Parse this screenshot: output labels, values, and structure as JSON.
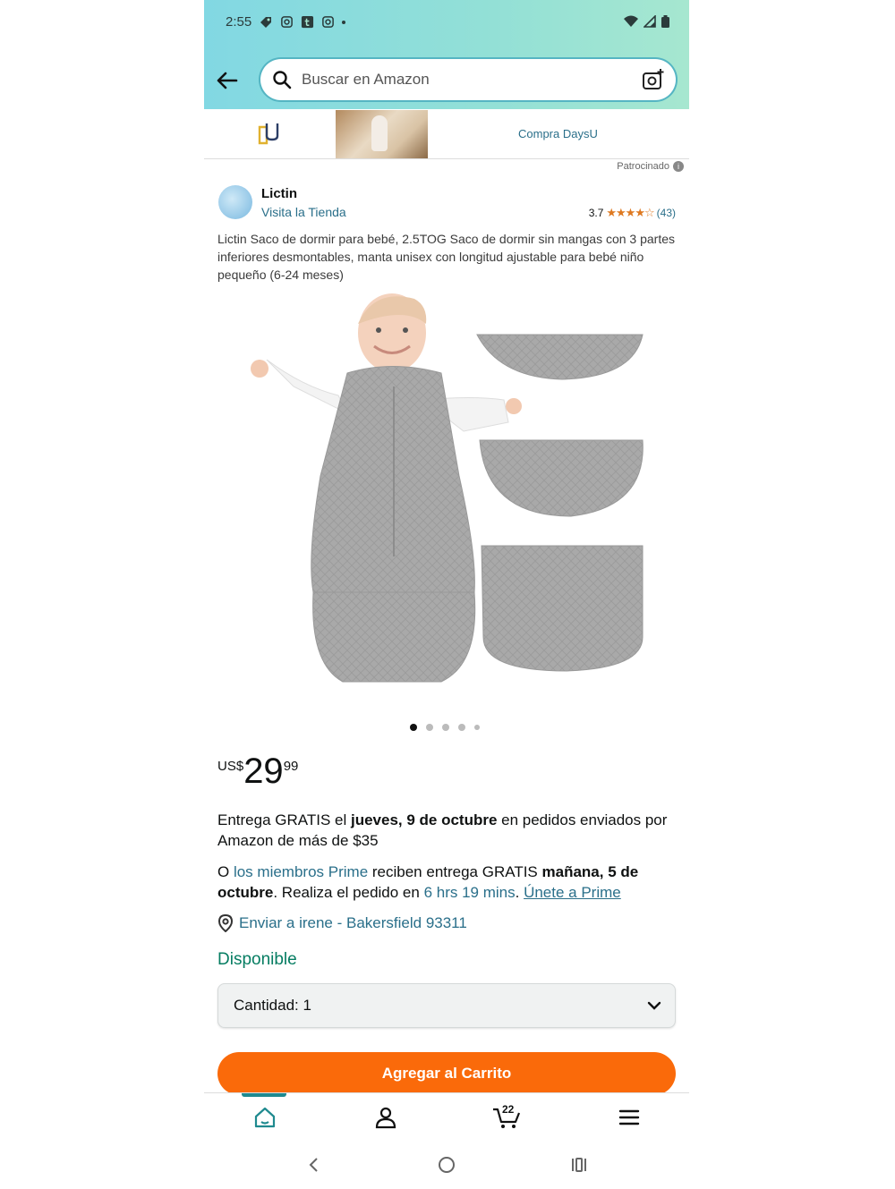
{
  "status_bar": {
    "time": "2:55"
  },
  "search": {
    "placeholder": "Buscar en Amazon"
  },
  "ad": {
    "link_text": "Compra DaysU",
    "sponsored_label": "Patrocinado"
  },
  "brand": {
    "name": "Lictin",
    "visit_store": "Visita la Tienda"
  },
  "rating": {
    "value": "3.7",
    "stars": "★★★★☆",
    "count": "(43)"
  },
  "product": {
    "title": "Lictin Saco de dormir para bebé, 2.5TOG Saco de dormir sin mangas con 3 partes inferiores desmontables, manta unisex con longitud ajustable para bebé niño pequeño (6-24 meses)",
    "image_count": 5,
    "active_image": 1
  },
  "price": {
    "currency": "US$",
    "whole": "29",
    "fraction": "99"
  },
  "delivery": {
    "part1": "Entrega GRATIS el ",
    "date": "jueves, 9 de octubre",
    "part2": " en pedidos enviados por Amazon de más de $35"
  },
  "prime": {
    "part1": "O ",
    "members_link": "los miembros Prime",
    "part2": " reciben entrega GRATIS ",
    "date": "mañana, 5 de octubre",
    "part3": ". Realiza el pedido en ",
    "countdown": "6 hrs 19 mins",
    "part4": ". ",
    "join_link": "Únete a Prime"
  },
  "ship_to": "Enviar a irene - Bakersfield 93311",
  "availability": "Disponible",
  "quantity": {
    "label": "Cantidad:",
    "value": "1"
  },
  "cart_button": "Agregar al Carrito",
  "bottom_nav": {
    "cart_count": "22"
  },
  "colors": {
    "accent": "#2a6f8a",
    "cart_button": "#fa6a0a",
    "available": "#067d62",
    "rating_star": "#de7921"
  }
}
